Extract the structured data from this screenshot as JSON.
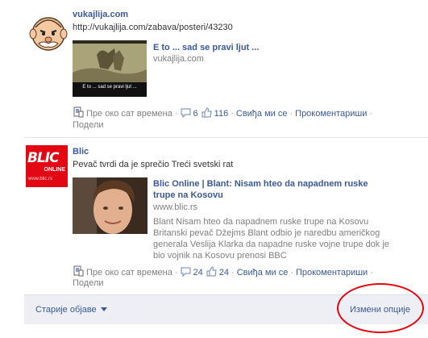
{
  "posts": [
    {
      "author": "vukajlija.com",
      "link": "http://vukajlija.com/zabava/posteri/43230",
      "attachment": {
        "title": "E to ... sad se pravi ljut ...",
        "host": "vukajlija.com",
        "image_caption": "E to ... sad se pravi ljut ..."
      },
      "meta": {
        "time": "Пре око сат времена",
        "comments": "6",
        "likes": "116",
        "like_action": "Свиђа ми се",
        "comment_action": "Прокоментариши",
        "share_action": "Подели"
      }
    },
    {
      "author": "Blic",
      "message": "Pevač tvrdi da je sprečio Treći svetski rat",
      "logo_text": "BLIC",
      "logo_subtext": "ONLINE",
      "logo_url": "www.blic.rs",
      "attachment": {
        "title_line1": "Blic Online | Blant: Nisam hteo da napadnem ruske",
        "title_line2": "trupe na Kosovu",
        "host": "www.blic.rs",
        "desc_line1": "Blant Nisam hteo da napadnem ruske trupe na Kosovu",
        "desc_line2": "Britanski pevač Džejms Blant odbio je naredbu američkog",
        "desc_line3": "generala Veslija Klarka da napadne ruske vojne trupe dok je",
        "desc_line4": "bio vojnik na Kosovu prenosi BBC"
      },
      "meta": {
        "time": "Пре око сат времена",
        "comments": "24",
        "likes": "24",
        "like_action": "Свиђа ми се",
        "comment_action": "Прокоментариши",
        "share_action": "Подели"
      }
    }
  ],
  "footer": {
    "older_posts": "Старије објаве",
    "edit_options": "Измени опције"
  },
  "colors": {
    "link": "#3b5998",
    "muted": "#808080",
    "annotation_circle": "#e3060f",
    "footer_bg": "#edeff4"
  }
}
